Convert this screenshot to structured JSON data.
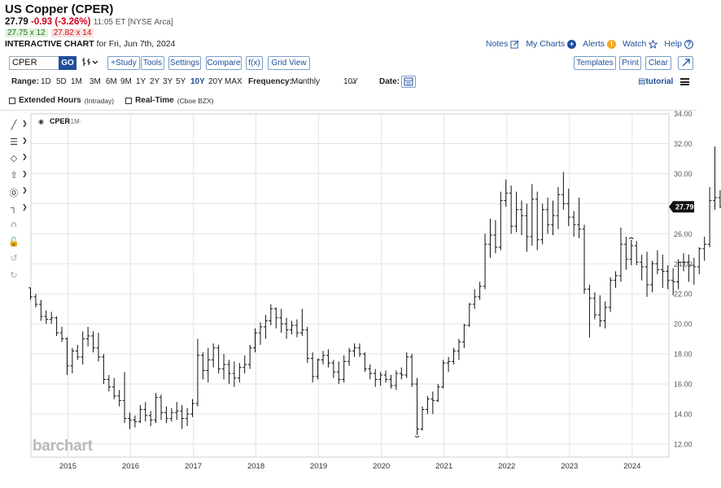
{
  "header": {
    "title": "US Copper (CPER)",
    "last": "27.79",
    "change": "-0.93 (-3.26%)",
    "time": "11:05 ET [NYSE Arca]",
    "bid": "27.75 x 12",
    "ask": "27.82 x 14",
    "chart_label": "INTERACTIVE CHART",
    "chart_date": "for Fri, Jun 7th, 2024"
  },
  "links": {
    "notes": "Notes",
    "mycharts": "My Charts",
    "alerts": "Alerts",
    "watch": "Watch",
    "help": "Help"
  },
  "toolbar": {
    "symbol": "CPER",
    "go": "GO",
    "study": "+Study",
    "tools": "Tools",
    "settings": "Settings",
    "compare": "Compare",
    "fx": "f(x)",
    "gridview": "Grid View",
    "templates": "Templates",
    "print": "Print",
    "clear": "Clear"
  },
  "rangebar": {
    "range_label": "Range:",
    "ranges": [
      "1D",
      "5D",
      "1M",
      "3M",
      "6M",
      "9M",
      "1Y",
      "2Y",
      "3Y",
      "5Y",
      "10Y",
      "20Y",
      "MAX"
    ],
    "selected_range": "10Y",
    "frequency_label": "Frequency:",
    "frequency": "Monthly",
    "period": "10Y",
    "date_label": "Date:",
    "tutorial": "tutorial"
  },
  "options": {
    "extended": "Extended Hours",
    "extended_sub": "(Intraday)",
    "realtime": "Real-Time",
    "realtime_sub": "(Cboe BZX)"
  },
  "watermark": "barchart",
  "colors": {
    "accent": "#1f4e9c",
    "negative": "#d0021b",
    "bar": "#111111",
    "grid": "#e3e3e3"
  },
  "chart_data": {
    "type": "ohlc",
    "legend": "CPER",
    "legend_interval": "·1M·",
    "last_price_label": "27.79",
    "y_ticks": [
      "12.00",
      "14.00",
      "16.00",
      "18.00",
      "20.00",
      "22.00",
      "24.00",
      "26.00",
      "28.00",
      "30.00",
      "32.00",
      "34.00"
    ],
    "ylim": [
      12,
      34
    ],
    "x_ticks": [
      "2015",
      "2016",
      "2017",
      "2018",
      "2019",
      "2020",
      "2021",
      "2022",
      "2023",
      "2024"
    ],
    "x_tick_index": [
      7,
      19,
      31,
      43,
      55,
      67,
      79,
      91,
      103,
      115
    ],
    "bars": [
      [
        22.4,
        22.4,
        21.6,
        21.8
      ],
      [
        21.8,
        22.0,
        21.1,
        21.3
      ],
      [
        21.3,
        21.6,
        20.2,
        20.5
      ],
      [
        20.5,
        20.9,
        20.0,
        20.3
      ],
      [
        20.3,
        20.8,
        20.0,
        20.4
      ],
      [
        20.4,
        20.5,
        19.2,
        19.4
      ],
      [
        19.4,
        19.8,
        18.8,
        19.0
      ],
      [
        19.0,
        19.1,
        16.6,
        17.2
      ],
      [
        17.2,
        18.4,
        16.7,
        18.2
      ],
      [
        18.2,
        18.6,
        17.6,
        17.8
      ],
      [
        17.8,
        19.5,
        17.3,
        19.0
      ],
      [
        19.0,
        19.8,
        18.5,
        19.2
      ],
      [
        19.2,
        19.5,
        18.1,
        18.4
      ],
      [
        18.4,
        19.4,
        17.5,
        17.8
      ],
      [
        17.8,
        18.0,
        16.0,
        16.3
      ],
      [
        16.3,
        16.6,
        15.5,
        15.8
      ],
      [
        15.8,
        16.4,
        15.0,
        15.2
      ],
      [
        15.2,
        15.6,
        14.5,
        14.9
      ],
      [
        14.9,
        16.8,
        13.4,
        13.7
      ],
      [
        13.7,
        14.1,
        13.0,
        13.6
      ],
      [
        13.6,
        13.9,
        13.1,
        13.5
      ],
      [
        13.5,
        14.6,
        13.4,
        14.3
      ],
      [
        14.3,
        14.8,
        13.5,
        13.9
      ],
      [
        13.9,
        14.2,
        13.2,
        13.6
      ],
      [
        13.6,
        15.4,
        13.4,
        15.1
      ],
      [
        15.1,
        15.3,
        13.6,
        14.1
      ],
      [
        14.1,
        14.5,
        13.4,
        13.7
      ],
      [
        13.7,
        14.4,
        13.5,
        14.1
      ],
      [
        14.1,
        14.8,
        13.6,
        14.2
      ],
      [
        14.2,
        14.6,
        13.0,
        13.7
      ],
      [
        13.7,
        14.4,
        13.2,
        14.0
      ],
      [
        14.0,
        15.0,
        13.8,
        14.7
      ],
      [
        14.7,
        19.0,
        14.5,
        17.9
      ],
      [
        17.9,
        18.1,
        16.3,
        16.9
      ],
      [
        16.9,
        18.4,
        16.1,
        17.6
      ],
      [
        17.6,
        18.7,
        17.1,
        18.4
      ],
      [
        18.4,
        18.6,
        16.7,
        17.0
      ],
      [
        17.0,
        18.0,
        16.3,
        17.3
      ],
      [
        17.3,
        17.6,
        16.0,
        16.7
      ],
      [
        16.7,
        17.5,
        15.8,
        16.4
      ],
      [
        16.4,
        17.4,
        16.1,
        17.1
      ],
      [
        17.1,
        17.9,
        16.7,
        17.3
      ],
      [
        17.3,
        18.6,
        17.0,
        18.4
      ],
      [
        18.4,
        19.7,
        18.1,
        19.4
      ],
      [
        19.4,
        20.1,
        18.6,
        19.8
      ],
      [
        19.8,
        20.6,
        19.0,
        20.2
      ],
      [
        20.2,
        21.3,
        19.9,
        21.0
      ],
      [
        21.0,
        21.1,
        19.7,
        20.4
      ],
      [
        20.4,
        21.0,
        19.4,
        20.0
      ],
      [
        20.0,
        20.4,
        19.0,
        19.6
      ],
      [
        19.6,
        20.2,
        19.3,
        19.9
      ],
      [
        19.9,
        20.3,
        19.1,
        19.4
      ],
      [
        19.4,
        21.0,
        19.2,
        19.6
      ],
      [
        19.6,
        19.8,
        17.4,
        17.7
      ],
      [
        17.7,
        18.1,
        16.1,
        16.5
      ],
      [
        16.5,
        17.7,
        16.3,
        17.6
      ],
      [
        17.6,
        18.2,
        17.3,
        17.9
      ],
      [
        17.9,
        18.3,
        17.1,
        17.4
      ],
      [
        17.4,
        17.6,
        16.4,
        16.8
      ],
      [
        16.8,
        17.5,
        16.0,
        16.3
      ],
      [
        16.3,
        17.9,
        16.1,
        17.5
      ],
      [
        17.5,
        18.4,
        17.2,
        18.2
      ],
      [
        18.2,
        18.7,
        17.8,
        18.4
      ],
      [
        18.4,
        18.7,
        17.8,
        18.0
      ],
      [
        18.0,
        18.1,
        16.8,
        17.0
      ],
      [
        17.0,
        17.3,
        16.3,
        16.7
      ],
      [
        16.7,
        17.0,
        15.8,
        16.3
      ],
      [
        16.3,
        16.8,
        15.9,
        16.6
      ],
      [
        16.6,
        16.9,
        16.1,
        16.3
      ],
      [
        16.3,
        16.6,
        15.7,
        15.9
      ],
      [
        15.9,
        16.9,
        15.6,
        16.7
      ],
      [
        16.7,
        17.1,
        16.3,
        16.6
      ],
      [
        16.6,
        18.1,
        16.4,
        17.8
      ],
      [
        17.8,
        18.0,
        15.8,
        16.0
      ],
      [
        16.0,
        16.4,
        12.6,
        13.0
      ],
      [
        13.0,
        14.5,
        12.9,
        14.3
      ],
      [
        14.3,
        15.2,
        14.0,
        15.0
      ],
      [
        15.0,
        15.5,
        14.0,
        14.9
      ],
      [
        14.9,
        16.0,
        14.8,
        15.8
      ],
      [
        15.8,
        17.6,
        15.7,
        17.4
      ],
      [
        17.4,
        17.8,
        16.8,
        17.5
      ],
      [
        17.5,
        18.4,
        17.3,
        18.2
      ],
      [
        18.2,
        19.0,
        17.6,
        18.8
      ],
      [
        18.8,
        20.0,
        18.4,
        19.9
      ],
      [
        19.9,
        21.4,
        19.8,
        21.3
      ],
      [
        21.3,
        22.3,
        21.0,
        21.8
      ],
      [
        21.8,
        22.8,
        21.6,
        22.5
      ],
      [
        22.5,
        26.0,
        22.3,
        25.3
      ],
      [
        25.3,
        27.0,
        24.4,
        25.9
      ],
      [
        25.9,
        26.9,
        24.7,
        25.1
      ],
      [
        25.1,
        28.8,
        24.9,
        28.2
      ],
      [
        28.2,
        29.6,
        27.8,
        28.7
      ],
      [
        28.7,
        29.2,
        26.0,
        26.5
      ],
      [
        26.5,
        28.8,
        26.1,
        27.6
      ],
      [
        27.6,
        28.2,
        25.9,
        27.2
      ],
      [
        27.2,
        28.0,
        24.8,
        25.8
      ],
      [
        25.8,
        29.3,
        25.2,
        28.3
      ],
      [
        28.3,
        28.8,
        24.9,
        25.6
      ],
      [
        25.6,
        28.0,
        25.3,
        27.6
      ],
      [
        27.6,
        28.4,
        26.0,
        26.6
      ],
      [
        26.6,
        28.2,
        25.9,
        27.2
      ],
      [
        27.2,
        29.1,
        26.3,
        28.6
      ],
      [
        28.6,
        30.1,
        27.6,
        28.0
      ],
      [
        28.0,
        29.0,
        26.5,
        27.1
      ],
      [
        27.1,
        27.5,
        25.8,
        26.6
      ],
      [
        26.6,
        28.4,
        25.7,
        26.3
      ],
      [
        26.3,
        26.6,
        22.0,
        22.3
      ],
      [
        22.3,
        22.6,
        19.1,
        21.7
      ],
      [
        21.7,
        22.1,
        20.3,
        20.6
      ],
      [
        20.6,
        21.9,
        19.8,
        20.2
      ],
      [
        20.2,
        21.5,
        19.7,
        21.1
      ],
      [
        21.1,
        23.1,
        20.8,
        22.9
      ],
      [
        22.9,
        23.5,
        22.4,
        23.2
      ],
      [
        23.2,
        26.4,
        22.8,
        25.3
      ],
      [
        25.3,
        25.8,
        23.6,
        24.3
      ],
      [
        24.3,
        25.6,
        23.9,
        25.2
      ],
      [
        25.2,
        25.5,
        23.9,
        24.1
      ],
      [
        24.1,
        24.6,
        22.9,
        23.8
      ],
      [
        23.8,
        24.8,
        21.8,
        22.6
      ],
      [
        22.6,
        24.2,
        22.1,
        24.0
      ],
      [
        24.0,
        24.9,
        23.3,
        23.6
      ],
      [
        23.6,
        24.6,
        22.4,
        23.5
      ],
      [
        23.5,
        23.9,
        22.3,
        22.9
      ],
      [
        22.9,
        23.7,
        21.9,
        22.8
      ],
      [
        22.8,
        24.3,
        22.3,
        24.1
      ],
      [
        24.1,
        24.7,
        23.5,
        24.1
      ],
      [
        24.1,
        24.6,
        22.8,
        23.9
      ],
      [
        23.9,
        24.4,
        22.6,
        23.8
      ],
      [
        23.8,
        25.1,
        23.3,
        25.0
      ],
      [
        25.0,
        25.8,
        24.2,
        25.3
      ],
      [
        25.3,
        29.1,
        25.1,
        28.2
      ],
      [
        28.2,
        31.8,
        27.6,
        28.4
      ],
      [
        28.4,
        28.9,
        27.7,
        27.8
      ]
    ]
  }
}
